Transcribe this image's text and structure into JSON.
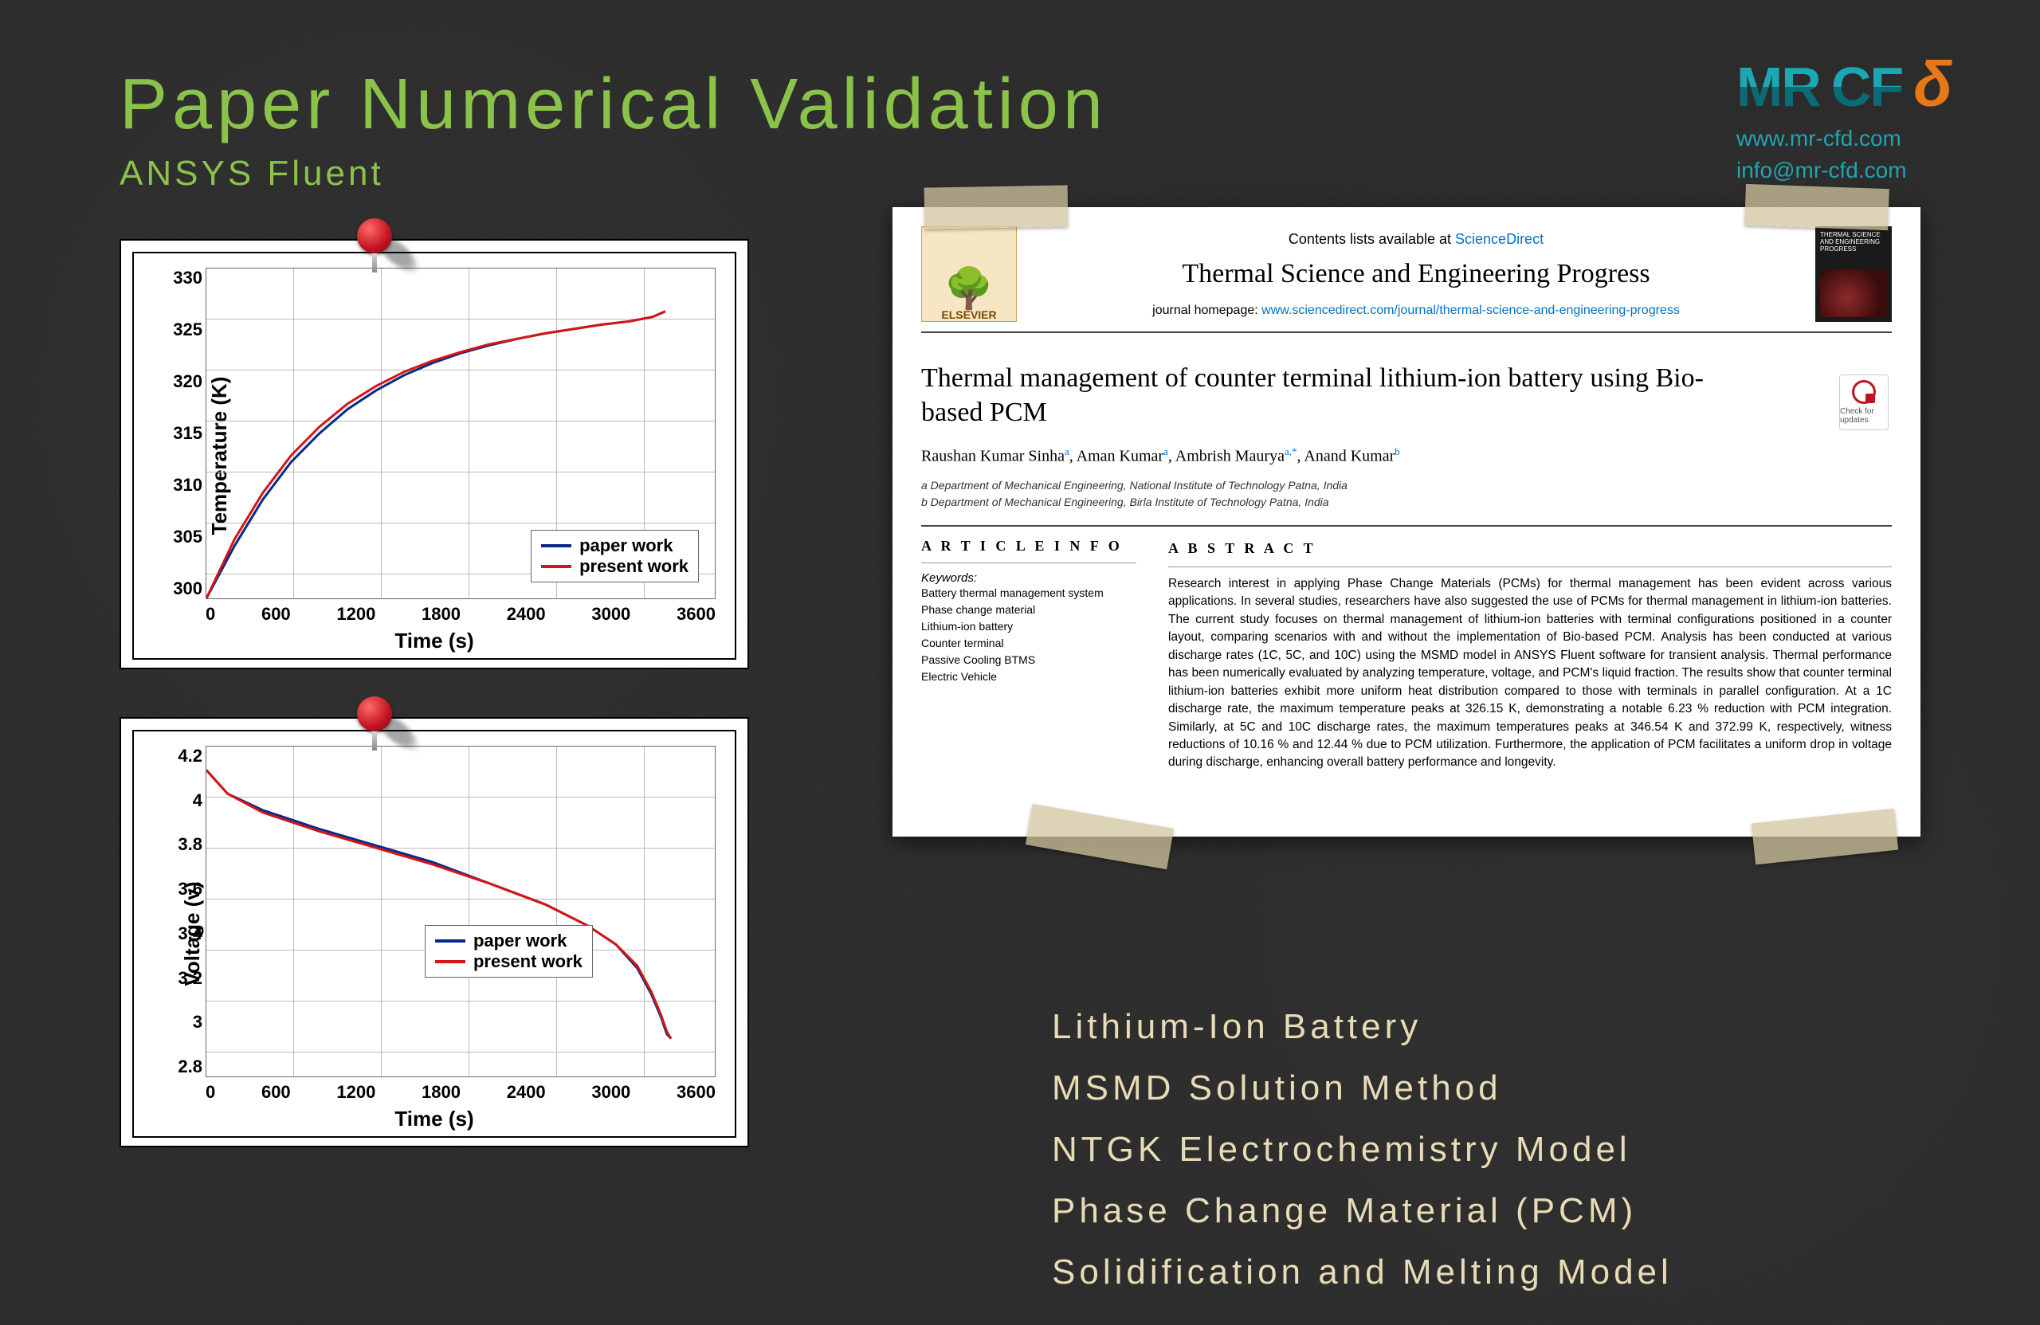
{
  "header": {
    "title": "Paper Numerical Validation",
    "subtitle": "ANSYS Fluent"
  },
  "logo": {
    "part1": "MR",
    "part2": "CF",
    "part3": "δ",
    "website": "www.mr-cfd.com",
    "email": "info@mr-cfd.com"
  },
  "chart_data": [
    {
      "type": "line",
      "title": "",
      "xlabel": "Time (s)",
      "ylabel": "Temperature (K)",
      "xlim": [
        0,
        3600
      ],
      "ylim": [
        300,
        330
      ],
      "x_ticks": [
        0,
        600,
        1200,
        1800,
        2400,
        3000,
        3600
      ],
      "y_ticks": [
        300,
        305,
        310,
        315,
        320,
        325,
        330
      ],
      "legend": [
        "paper work",
        "present work"
      ],
      "series": [
        {
          "name": "paper work",
          "color": "#0a2a8a",
          "x": [
            0,
            200,
            400,
            600,
            800,
            1000,
            1200,
            1400,
            1600,
            1800,
            2000,
            2200,
            2400,
            2600,
            2800,
            3000,
            3160,
            3250
          ],
          "y": [
            300.0,
            304.8,
            309.0,
            312.4,
            315.0,
            317.2,
            318.9,
            320.3,
            321.4,
            322.3,
            323.0,
            323.6,
            324.1,
            324.5,
            324.9,
            325.2,
            325.6,
            326.1
          ]
        },
        {
          "name": "present work",
          "color": "#d31515",
          "x": [
            0,
            200,
            400,
            600,
            800,
            1000,
            1200,
            1400,
            1600,
            1800,
            2000,
            2200,
            2400,
            2600,
            2800,
            3000,
            3160,
            3250
          ],
          "y": [
            300.0,
            305.4,
            309.6,
            313.0,
            315.6,
            317.7,
            319.3,
            320.6,
            321.6,
            322.4,
            323.1,
            323.6,
            324.1,
            324.5,
            324.9,
            325.2,
            325.6,
            326.1
          ]
        }
      ]
    },
    {
      "type": "line",
      "title": "",
      "xlabel": "Time (s)",
      "ylabel": "Voltage (v)",
      "xlim": [
        0,
        3600
      ],
      "ylim": [
        2.8,
        4.2
      ],
      "x_ticks": [
        0,
        600,
        1200,
        1800,
        2400,
        3000,
        3600
      ],
      "y_ticks": [
        2.8,
        3,
        3.2,
        3.4,
        3.6,
        3.8,
        4,
        4.2
      ],
      "legend": [
        "paper work",
        "present work"
      ],
      "series": [
        {
          "name": "paper work",
          "color": "#0a2a8a",
          "x": [
            0,
            150,
            400,
            800,
            1200,
            1600,
            2000,
            2400,
            2700,
            2900,
            3050,
            3150,
            3220,
            3260,
            3290
          ],
          "y": [
            4.1,
            4.0,
            3.93,
            3.85,
            3.78,
            3.71,
            3.62,
            3.53,
            3.44,
            3.36,
            3.26,
            3.15,
            3.05,
            2.98,
            2.96
          ]
        },
        {
          "name": "present work",
          "color": "#d31515",
          "x": [
            0,
            150,
            400,
            800,
            1200,
            1600,
            2000,
            2400,
            2700,
            2900,
            3050,
            3150,
            3220,
            3260,
            3290
          ],
          "y": [
            4.1,
            4.0,
            3.92,
            3.84,
            3.77,
            3.7,
            3.62,
            3.53,
            3.44,
            3.36,
            3.27,
            3.16,
            3.06,
            2.99,
            2.96
          ]
        }
      ]
    }
  ],
  "paper": {
    "publisher": "ELSEVIER",
    "contents_prefix": "Contents lists available at ",
    "contents_link": "ScienceDirect",
    "journal": "Thermal Science and Engineering Progress",
    "homepage_prefix": "journal homepage: ",
    "homepage_link": "www.sciencedirect.com/journal/thermal-science-and-engineering-progress",
    "cover_text": "THERMAL SCIENCE AND ENGINEERING PROGRESS",
    "check_label": "Check for updates",
    "title": "Thermal management of counter terminal lithium-ion battery using Bio-based PCM",
    "authors_html": "Raushan Kumar Sinha<sup>a</sup>, Aman Kumar<sup>a</sup>, Ambrish Maurya<sup>a,*</sup>, Anand Kumar<sup>b</sup>",
    "affiliations": [
      "a Department of Mechanical Engineering, National Institute of Technology Patna, India",
      "b Department of Mechanical Engineering, Birla Institute of Technology Patna, India"
    ],
    "info_heading": "A R T I C L E  I N F O",
    "keywords_label": "Keywords:",
    "keywords": [
      "Battery thermal management system",
      "Phase change material",
      "Lithium-ion battery",
      "Counter terminal",
      "Passive Cooling BTMS",
      "Electric Vehicle"
    ],
    "abstract_heading": "A B S T R A C T",
    "abstract": "Research interest in applying Phase Change Materials (PCMs) for thermal management has been evident across various applications. In several studies, researchers have also suggested the use of PCMs for thermal management in lithium-ion batteries. The current study focuses on thermal management of lithium-ion batteries with terminal configurations positioned in a counter layout, comparing scenarios with and without the implementation of Bio-based PCM. Analysis has been conducted at various discharge rates (1C, 5C, and 10C) using the MSMD model in ANSYS Fluent software for transient analysis. Thermal performance has been numerically evaluated by analyzing temperature, voltage, and PCM's liquid fraction. The results show that counter terminal lithium-ion batteries exhibit more uniform heat distribution compared to those with terminals in parallel configuration. At a 1C discharge rate, the maximum temperature peaks at 326.15 K, demonstrating a notable 6.23 % reduction with PCM integration. Similarly, at 5C and 10C discharge rates, the maximum temperatures peaks at 346.54 K and 372.99 K, respectively, witness reductions of 10.16 % and 12.44 % due to PCM utilization. Furthermore, the application of PCM facilitates a uniform drop in voltage during discharge, enhancing overall battery performance and longevity."
  },
  "topics": [
    "Lithium-Ion Battery",
    "MSMD Solution Method",
    "NTGK Electrochemistry Model",
    "Phase Change Material (PCM)",
    "Solidification and Melting Model"
  ]
}
